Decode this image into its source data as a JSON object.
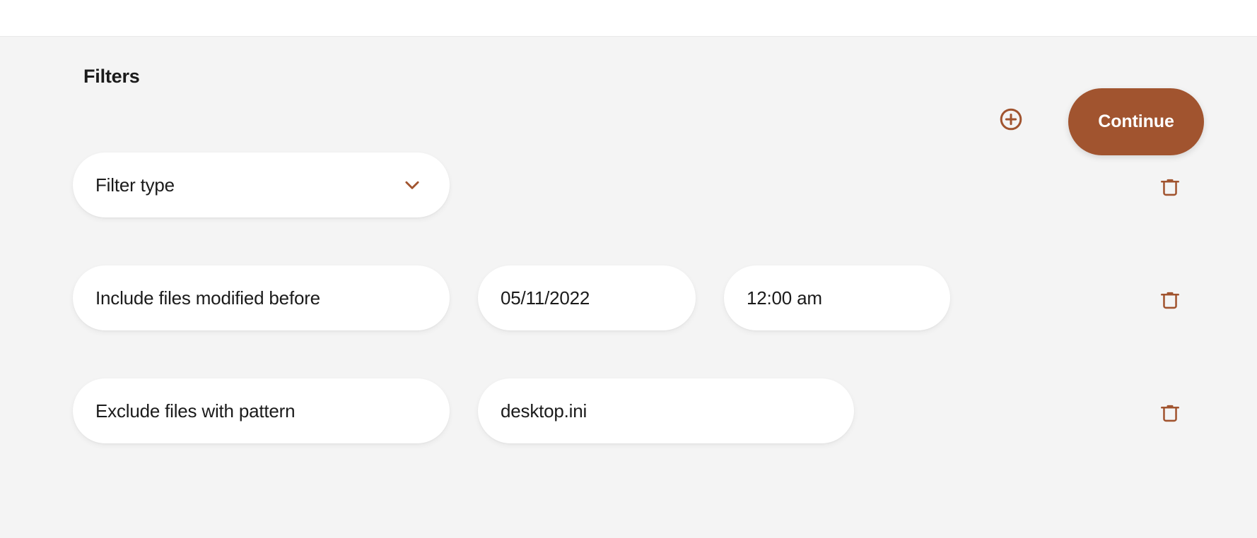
{
  "theme": {
    "accent": "#a1542f",
    "page_background": "#f4f4f4",
    "topbar_background": "#ffffff",
    "field_background": "#ffffff",
    "text_color": "#1b1b1b",
    "button_text_color": "#ffffff"
  },
  "header": {
    "title": "Filters",
    "add_filter_icon": "plus-circle-icon",
    "continue_label": "Continue"
  },
  "rows": [
    {
      "id": "filter-type",
      "fields": [
        {
          "kind": "select",
          "name": "filter-type-select",
          "value": "Filter type",
          "icon": "chevron-down-icon"
        }
      ],
      "delete_icon": "trash-icon"
    },
    {
      "id": "include-files-modified-before",
      "fields": [
        {
          "kind": "select",
          "name": "filter-type-select",
          "value": "Include files modified before"
        },
        {
          "kind": "date",
          "name": "date-input",
          "value": "05/11/2022"
        },
        {
          "kind": "time",
          "name": "time-input",
          "value": "12:00 am"
        }
      ],
      "delete_icon": "trash-icon"
    },
    {
      "id": "exclude-files-with-pattern",
      "fields": [
        {
          "kind": "select",
          "name": "filter-type-select",
          "value": "Exclude files with pattern"
        },
        {
          "kind": "text",
          "name": "pattern-input",
          "value": "desktop.ini"
        }
      ],
      "delete_icon": "trash-icon"
    }
  ]
}
